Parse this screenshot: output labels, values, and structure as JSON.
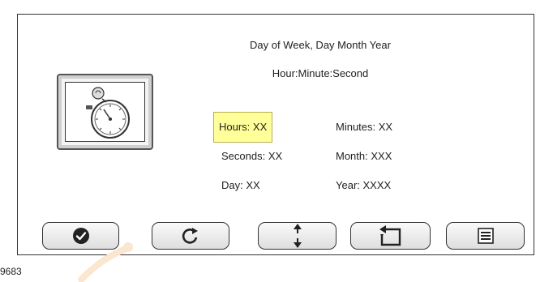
{
  "header": {
    "date_line": "Day of Week, Day Month Year",
    "time_line": "Hour:Minute:Second"
  },
  "fields": {
    "hours": "Hours: XX",
    "minutes": "Minutes: XX",
    "seconds": "Seconds: XX",
    "month": "Month: XXX",
    "day": "Day: XX",
    "year": "Year: XXXX",
    "selected": "hours",
    "highlight_color": "#ffff99"
  },
  "buttons": [
    {
      "id": "confirm",
      "icon": "check-circle-icon"
    },
    {
      "id": "refresh",
      "icon": "rotate-icon"
    },
    {
      "id": "adjust",
      "icon": "up-down-arrows-icon"
    },
    {
      "id": "back",
      "icon": "return-arrow-icon"
    },
    {
      "id": "menu",
      "icon": "menu-list-icon"
    }
  ],
  "figure_id": "9683"
}
